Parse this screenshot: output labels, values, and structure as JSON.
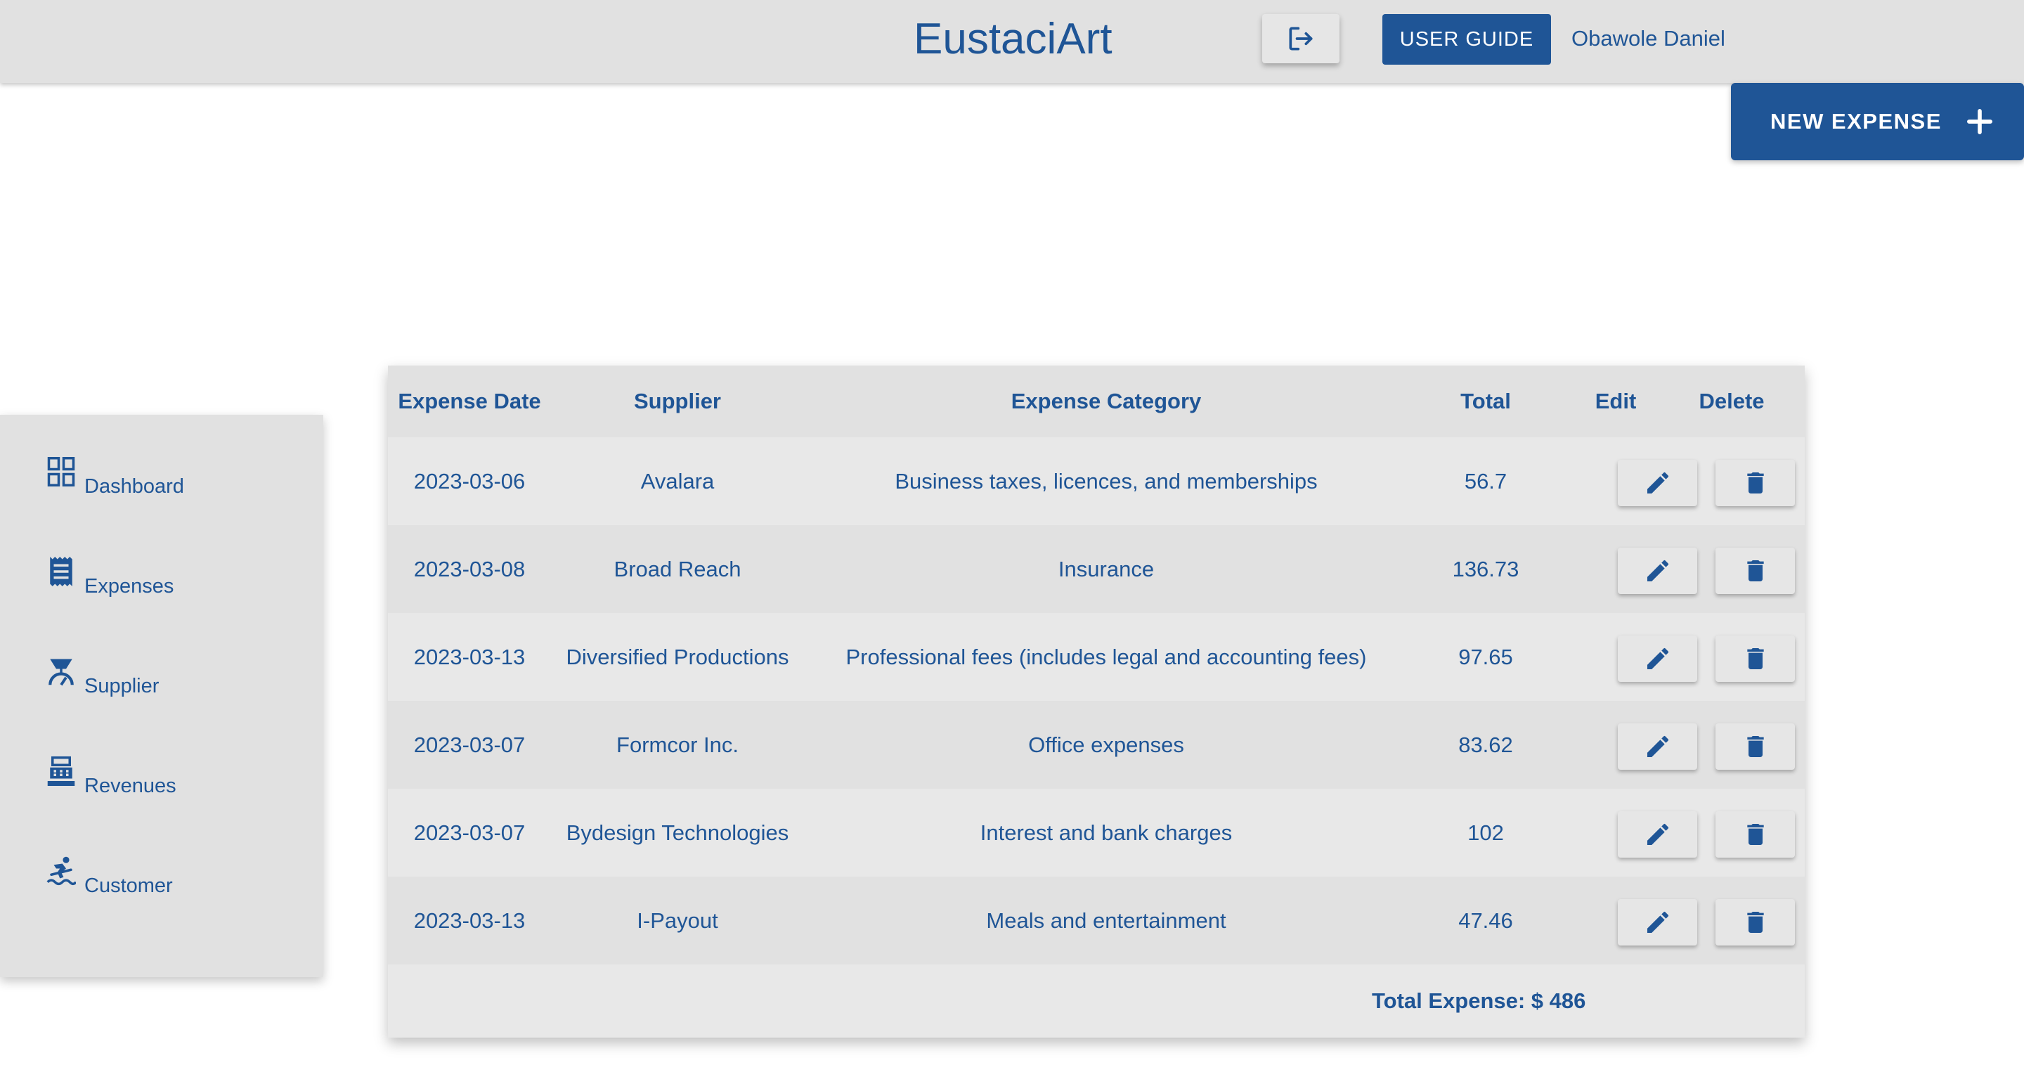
{
  "header": {
    "brand": "EustaciArt",
    "logout_icon": "logout-icon",
    "user_guide_label": "USER GUIDE",
    "username": "Obawole Daniel"
  },
  "actions": {
    "new_expense_label": "NEW EXPENSE",
    "new_expense_icon": "plus-icon"
  },
  "sidebar": {
    "items": [
      {
        "label": "Dashboard",
        "icon": "dashboard-grid-icon"
      },
      {
        "label": "Expenses",
        "icon": "receipt-icon"
      },
      {
        "label": "Supplier",
        "icon": "supplier-scale-icon"
      },
      {
        "label": "Revenues",
        "icon": "cash-register-icon"
      },
      {
        "label": "Customer",
        "icon": "surfer-icon"
      }
    ]
  },
  "table": {
    "columns": [
      "Expense Date",
      "Supplier",
      "Expense Category",
      "Total",
      "Edit",
      "Delete"
    ],
    "rows": [
      {
        "date": "2023-03-06",
        "supplier": "Avalara",
        "category": "Business taxes, licences, and memberships",
        "total": "56.7"
      },
      {
        "date": "2023-03-08",
        "supplier": "Broad Reach",
        "category": "Insurance",
        "total": "136.73"
      },
      {
        "date": "2023-03-13",
        "supplier": "Diversified Productions",
        "category": "Professional fees (includes legal and accounting fees)",
        "total": "97.65"
      },
      {
        "date": "2023-03-07",
        "supplier": "Formcor Inc.",
        "category": "Office expenses",
        "total": "83.62"
      },
      {
        "date": "2023-03-07",
        "supplier": "Bydesign Technologies",
        "category": "Interest and bank charges",
        "total": "102"
      },
      {
        "date": "2023-03-13",
        "supplier": "I-Payout",
        "category": "Meals and entertainment",
        "total": "47.46"
      }
    ],
    "edit_icon": "pencil-icon",
    "delete_icon": "trash-icon",
    "total_label": "Total Expense: $ 486"
  },
  "colors": {
    "accent": "#1f5596",
    "topbar_bg": "#e1e1e1",
    "row_bg": "#e8e8e8",
    "row_alt_bg": "#e1e1e1"
  }
}
